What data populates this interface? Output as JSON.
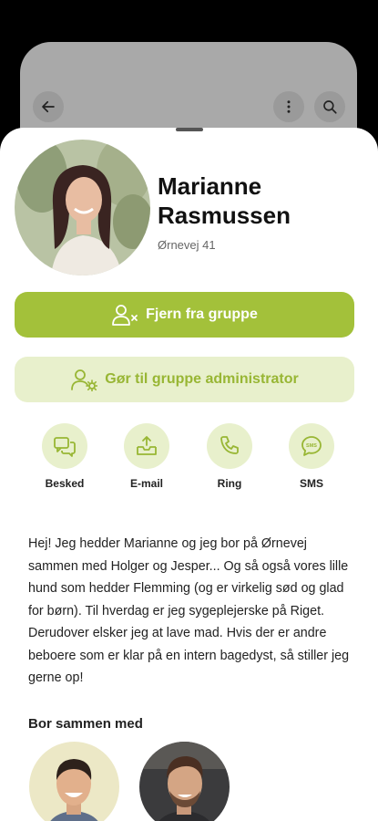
{
  "profile": {
    "name": "Marianne Rasmussen",
    "address": "Ørnevej 41"
  },
  "buttons": {
    "remove_label": "Fjern fra gruppe",
    "admin_label": "Gør til gruppe administrator"
  },
  "actions": [
    {
      "label": "Besked",
      "icon": "chat-icon"
    },
    {
      "label": "E-mail",
      "icon": "inbox-upload-icon"
    },
    {
      "label": "Ring",
      "icon": "phone-icon"
    },
    {
      "label": "SMS",
      "icon": "sms-icon"
    }
  ],
  "bio": "Hej! Jeg hedder Marianne og jeg bor på Ørnevej sammen med Holger og Jesper... Og så også vores lille hund som hedder Flemming (og er virkelig sød og glad for børn). Til hverdag er jeg sygeplejerske på Riget. Derudover elsker jeg at lave mad. Hvis der er andre beboere som er klar på en intern bagedyst, så stiller jeg gerne op!",
  "roommates": {
    "title": "Bor sammen med"
  },
  "colors": {
    "accent": "#a3c13a",
    "accent_light": "#e8f0cc"
  }
}
